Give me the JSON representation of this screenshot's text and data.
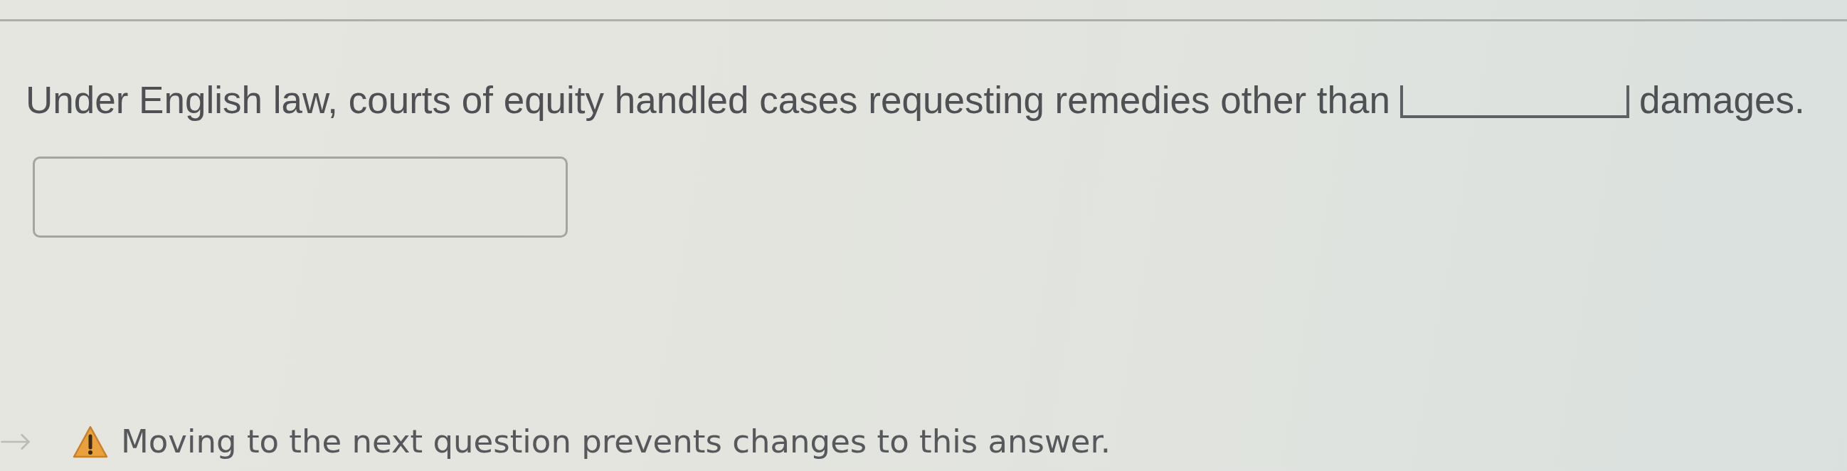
{
  "question": {
    "parts": [
      {
        "kind": "text",
        "text": "Under English law, courts of equity handled cases requesting remedies other than"
      },
      {
        "kind": "blank"
      },
      {
        "kind": "text",
        "text": "damages."
      }
    ]
  },
  "answer_fields": [
    {
      "kind": "box"
    }
  ],
  "notice": {
    "text": "Moving to the next question prevents changes to this answer."
  }
}
